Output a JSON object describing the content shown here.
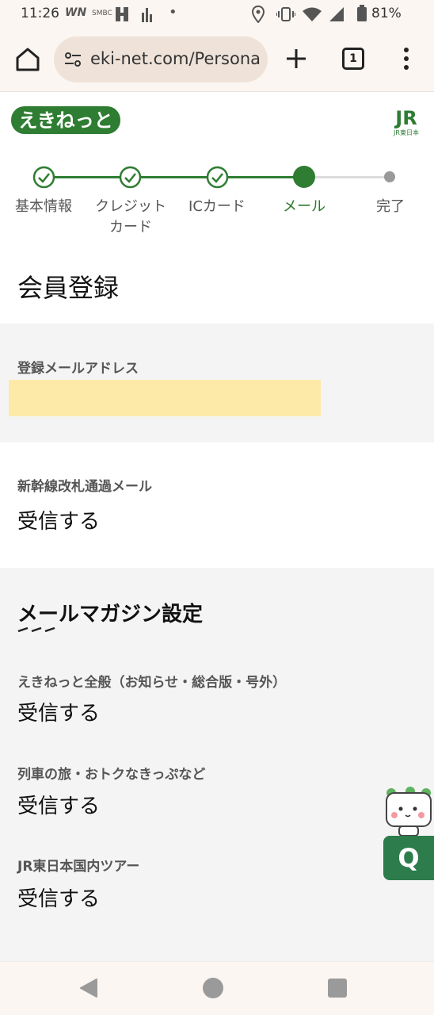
{
  "status": {
    "time": "11:26",
    "battery": "81%",
    "left_icons": [
      "WN",
      "SMBC",
      "grid",
      "chart",
      "•"
    ],
    "right_icons": [
      "location-icon",
      "vibrate-icon",
      "wifi-icon",
      "signal-icon",
      "battery-icon"
    ]
  },
  "browser": {
    "url": "eki-net.com/Persona",
    "tab_count": "1"
  },
  "site": {
    "logo_text": "えきねっと",
    "jr_logo": "JR",
    "jr_sub": "JR東日本"
  },
  "stepper": {
    "steps": [
      {
        "label_line1": "基本情報",
        "label_line2": "",
        "state": "done"
      },
      {
        "label_line1": "クレジット",
        "label_line2": "カード",
        "state": "done"
      },
      {
        "label_line1": "ICカード",
        "label_line2": "",
        "state": "done"
      },
      {
        "label_line1": "メール",
        "label_line2": "",
        "state": "current"
      },
      {
        "label_line1": "完了",
        "label_line2": "",
        "state": "todo"
      }
    ]
  },
  "page": {
    "title": "会員登録"
  },
  "fields": {
    "email_label": "登録メールアドレス",
    "email_value": "",
    "shinkansen_label": "新幹線改札通過メール",
    "shinkansen_value": "受信する"
  },
  "magazine": {
    "heading": "メールマガジン設定",
    "items": [
      {
        "label": "えきねっと全般（お知らせ・総合版・号外）",
        "value": "受信する"
      },
      {
        "label": "列車の旅・おトクなきっぷなど",
        "value": "受信する"
      },
      {
        "label": "JR東日本国内ツアー",
        "value": "受信する"
      }
    ]
  },
  "help": {
    "label": "Q"
  },
  "colors": {
    "brand_green": "#2e7d32",
    "help_green": "#2d7c4b",
    "mask_yellow": "#fde9a8",
    "section_gray": "#f4f4f4"
  }
}
